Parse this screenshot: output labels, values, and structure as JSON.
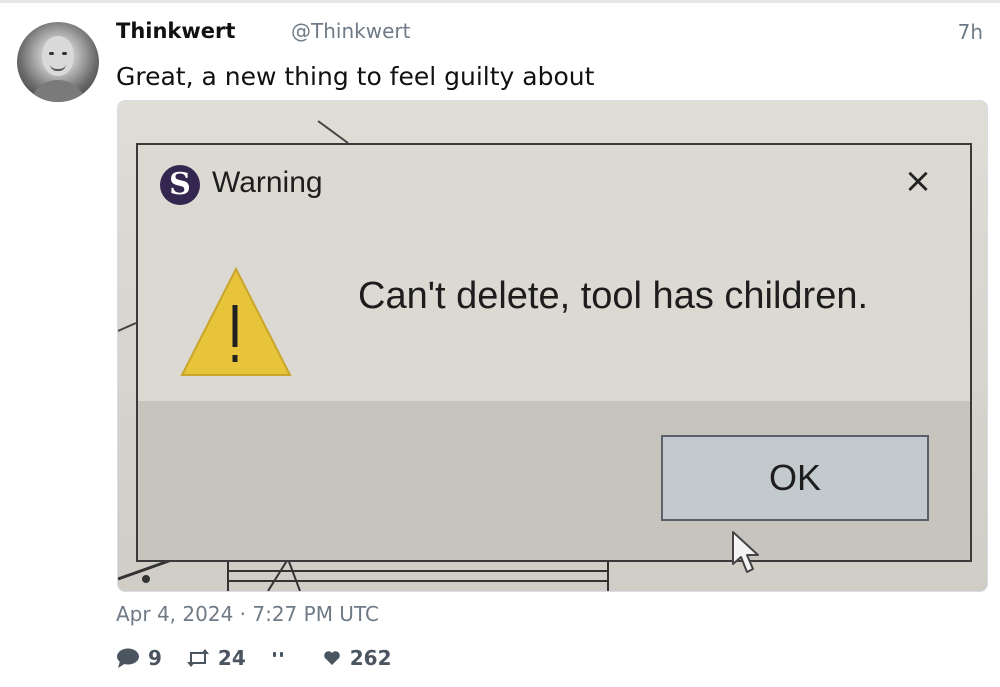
{
  "post": {
    "display_name": "Thinkwert",
    "handle": "@Thinkwert",
    "relative_time": "7h",
    "text": "Great, a new thing to feel guilty about",
    "date": "Apr 4, 2024 · 7:27 PM UTC"
  },
  "media": {
    "dialog_title": "Warning",
    "close_glyph": "×",
    "logo_letter": "S",
    "message": "Can't delete, tool has children.",
    "ok_label": "OK"
  },
  "stats": {
    "replies": "9",
    "reposts": "24",
    "likes": "262"
  },
  "icons": [
    "avatar",
    "chat-bubble-icon",
    "repost-icon",
    "quote-icon",
    "heart-icon",
    "warning-triangle-icon",
    "close-icon",
    "cursor-icon",
    "app-logo-icon"
  ]
}
